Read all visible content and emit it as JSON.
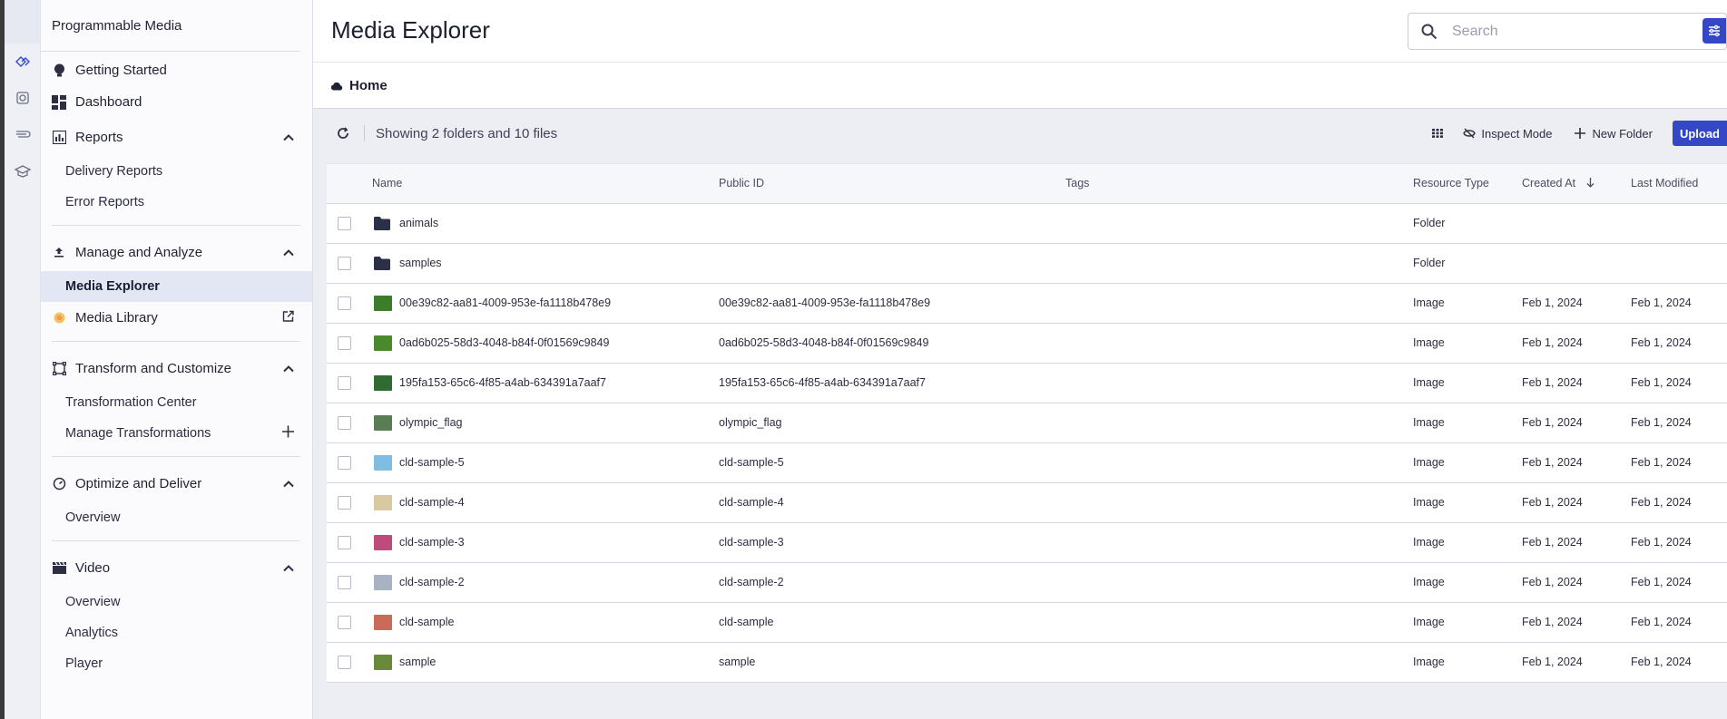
{
  "sidebar": {
    "title": "Programmable Media",
    "items": [
      {
        "label": "Getting Started"
      },
      {
        "label": "Dashboard"
      }
    ],
    "reports": {
      "label": "Reports",
      "subs": [
        "Delivery Reports",
        "Error Reports"
      ]
    },
    "manage": {
      "label": "Manage and Analyze",
      "subs": [
        "Media Explorer"
      ],
      "library": "Media Library"
    },
    "transform": {
      "label": "Transform and Customize",
      "subs": [
        "Transformation Center",
        "Manage Transformations"
      ]
    },
    "optimize": {
      "label": "Optimize and Deliver",
      "subs": [
        "Overview"
      ]
    },
    "video": {
      "label": "Video",
      "subs": [
        "Overview",
        "Analytics",
        "Player"
      ]
    }
  },
  "header": {
    "title": "Media Explorer",
    "search_placeholder": "Search"
  },
  "breadcrumb": {
    "label": "Home"
  },
  "toolbar": {
    "showing": "Showing 2 folders and 10 files",
    "inspect": "Inspect Mode",
    "new_folder": "New Folder",
    "upload": "Upload"
  },
  "table": {
    "columns": [
      "Name",
      "Public ID",
      "Tags",
      "Resource Type",
      "Created At",
      "Last Modified"
    ],
    "rows": [
      {
        "name": "animals",
        "public_id": "",
        "type": "Folder",
        "created": "",
        "modified": "",
        "kind": "folder"
      },
      {
        "name": "samples",
        "public_id": "",
        "type": "Folder",
        "created": "",
        "modified": "",
        "kind": "folder"
      },
      {
        "name": "00e39c82-aa81-4009-953e-fa1118b478e9",
        "public_id": "00e39c82-aa81-4009-953e-fa1118b478e9",
        "type": "Image",
        "created": "Feb 1, 2024",
        "modified": "Feb 1, 2024",
        "kind": "image",
        "thumb": "#3c7d2a"
      },
      {
        "name": "0ad6b025-58d3-4048-b84f-0f01569c9849",
        "public_id": "0ad6b025-58d3-4048-b84f-0f01569c9849",
        "type": "Image",
        "created": "Feb 1, 2024",
        "modified": "Feb 1, 2024",
        "kind": "image",
        "thumb": "#4a8a2f"
      },
      {
        "name": "195fa153-65c6-4f85-a4ab-634391a7aaf7",
        "public_id": "195fa153-65c6-4f85-a4ab-634391a7aaf7",
        "type": "Image",
        "created": "Feb 1, 2024",
        "modified": "Feb 1, 2024",
        "kind": "image",
        "thumb": "#2f6b33"
      },
      {
        "name": "olympic_flag",
        "public_id": "olympic_flag",
        "type": "Image",
        "created": "Feb 1, 2024",
        "modified": "Feb 1, 2024",
        "kind": "image",
        "thumb": "#5a7d55"
      },
      {
        "name": "cld-sample-5",
        "public_id": "cld-sample-5",
        "type": "Image",
        "created": "Feb 1, 2024",
        "modified": "Feb 1, 2024",
        "kind": "image",
        "thumb": "#7fbde3"
      },
      {
        "name": "cld-sample-4",
        "public_id": "cld-sample-4",
        "type": "Image",
        "created": "Feb 1, 2024",
        "modified": "Feb 1, 2024",
        "kind": "image",
        "thumb": "#d9c9a3"
      },
      {
        "name": "cld-sample-3",
        "public_id": "cld-sample-3",
        "type": "Image",
        "created": "Feb 1, 2024",
        "modified": "Feb 1, 2024",
        "kind": "image",
        "thumb": "#c04a7a"
      },
      {
        "name": "cld-sample-2",
        "public_id": "cld-sample-2",
        "type": "Image",
        "created": "Feb 1, 2024",
        "modified": "Feb 1, 2024",
        "kind": "image",
        "thumb": "#a7b3c2"
      },
      {
        "name": "cld-sample",
        "public_id": "cld-sample",
        "type": "Image",
        "created": "Feb 1, 2024",
        "modified": "Feb 1, 2024",
        "kind": "image",
        "thumb": "#c96a5a"
      },
      {
        "name": "sample",
        "public_id": "sample",
        "type": "Image",
        "created": "Feb 1, 2024",
        "modified": "Feb 1, 2024",
        "kind": "image",
        "thumb": "#6a8a3a"
      }
    ]
  },
  "colors": {
    "accent": "#3448c5",
    "selected_bg": "#e3e6f3"
  }
}
